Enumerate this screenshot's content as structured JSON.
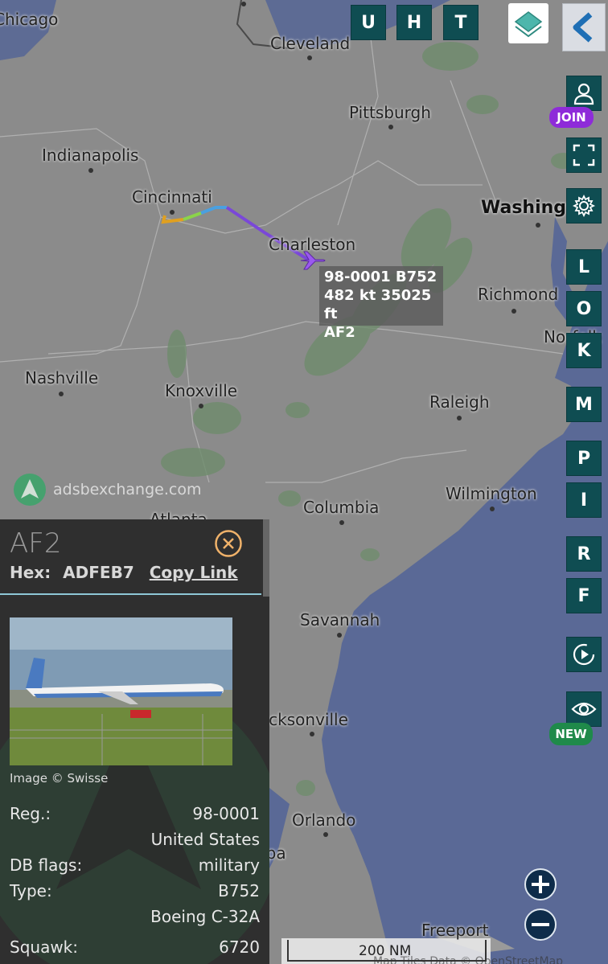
{
  "top_buttons": [
    "U",
    "H",
    "T"
  ],
  "right_buttons": {
    "L": "L",
    "O": "O",
    "K": "K",
    "M": "M",
    "P": "P",
    "I": "I",
    "R": "R",
    "F": "F"
  },
  "badges": {
    "join": "JOIN",
    "new": "NEW"
  },
  "cities": {
    "chicago": "Chicago",
    "cleveland": "Cleveland",
    "pittsburgh": "Pittsburgh",
    "indianapolis": "Indianapolis",
    "cincinnati": "Cincinnati",
    "washington": "Washingt",
    "charleston": "Charleston",
    "richmond": "Richmond",
    "norfolk": "Norfolk",
    "nashville": "Nashville",
    "knoxville": "Knoxville",
    "raleigh": "Raleigh",
    "wilmington": "Wilmington",
    "atlanta": "Atlanta",
    "columbia": "Columbia",
    "savannah": "Savannah",
    "jacksonville": "Jacksonville",
    "orlando": "Orlando",
    "tampa": "Tampa",
    "freeport": "Freeport"
  },
  "watermark": "adsbexchange.com",
  "aircraft_label": {
    "line1": "98-0001 B752",
    "line2": "482 kt  35025 ft",
    "line3": "AF2"
  },
  "panel": {
    "callsign": "AF2",
    "hex_label": "Hex:",
    "hex_value": "ADFEB7",
    "copy_link": "Copy Link",
    "image_credit": "Image © Swisse",
    "rows": {
      "reg_key": "Reg.:",
      "reg_value": "98-0001",
      "country": "United States",
      "flags_key": "DB flags:",
      "flags_value": "military",
      "type_key": "Type:",
      "type_value": "B752",
      "type_name": "Boeing C-32A",
      "squawk_key": "Squawk:",
      "squawk_value": "6720"
    }
  },
  "scale": {
    "label": "200 NM"
  },
  "attribution": "Map Tiles Data © OpenStreetMap",
  "colors": {
    "land": "#8c8c8c",
    "water": "#5a6a96",
    "button": "#0f4d52",
    "join": "#8e2bd9",
    "new": "#1f8a4a",
    "panel": "#2f2f2f"
  }
}
